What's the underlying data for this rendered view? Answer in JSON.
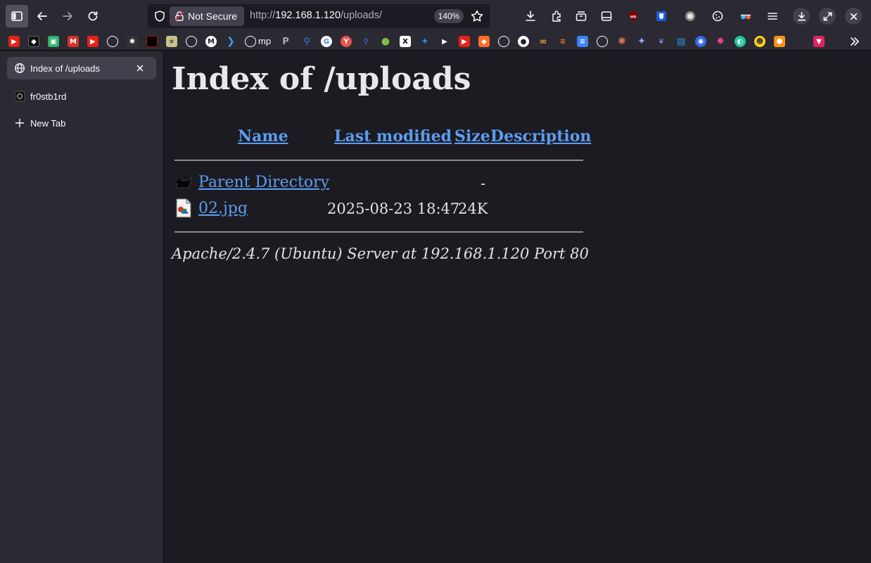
{
  "toolbar": {
    "security_label": "Not Secure",
    "url_prefix": "http://",
    "url_host": "192.168.1.120",
    "url_path": "/uploads/",
    "zoom": "140%"
  },
  "bookmarks": {
    "items": [
      {
        "icon": "youtube-icon",
        "color": "#e62117"
      },
      {
        "icon": "app-icon",
        "color": "#222222"
      },
      {
        "icon": "puzzle-icon",
        "color": "#2fb36d"
      },
      {
        "icon": "gmail-icon",
        "color": "#d93025"
      },
      {
        "icon": "youtube-icon",
        "color": "#e62117"
      },
      {
        "icon": "globe-icon",
        "color": "#ffffff"
      },
      {
        "icon": "bug-icon",
        "color": "#333333"
      },
      {
        "icon": "netflix-icon",
        "color": "#b20710"
      },
      {
        "icon": "star-icon",
        "color": "#c8c38a"
      },
      {
        "icon": "globe-icon",
        "color": "#ffffff"
      },
      {
        "icon": "m-icon",
        "color": "#ffffff"
      },
      {
        "icon": "arrow-icon",
        "color": "#3aa0f0"
      }
    ],
    "mp_label": "mp"
  },
  "sidebar": {
    "tabs": [
      {
        "label": "Index of /uploads"
      },
      {
        "label": "fr0stb1rd"
      },
      {
        "label": "New Tab"
      }
    ]
  },
  "page": {
    "title": "Index of /uploads",
    "columns": {
      "name": "Name",
      "last_modified": "Last modified",
      "size": "Size",
      "description": "Description"
    },
    "rows": [
      {
        "name": "Parent Directory",
        "modified": "",
        "size": "-",
        "icon": "back-folder-icon"
      },
      {
        "name": "02.jpg",
        "modified": "2025-08-23 18:47",
        "size": "24K",
        "icon": "image-file-icon"
      }
    ],
    "footer": "Apache/2.4.7 (Ubuntu) Server at 192.168.1.120 Port 80"
  },
  "colors": {
    "link": "#5b9df0",
    "background": "#1c1b22",
    "chrome": "#2b2a33"
  }
}
